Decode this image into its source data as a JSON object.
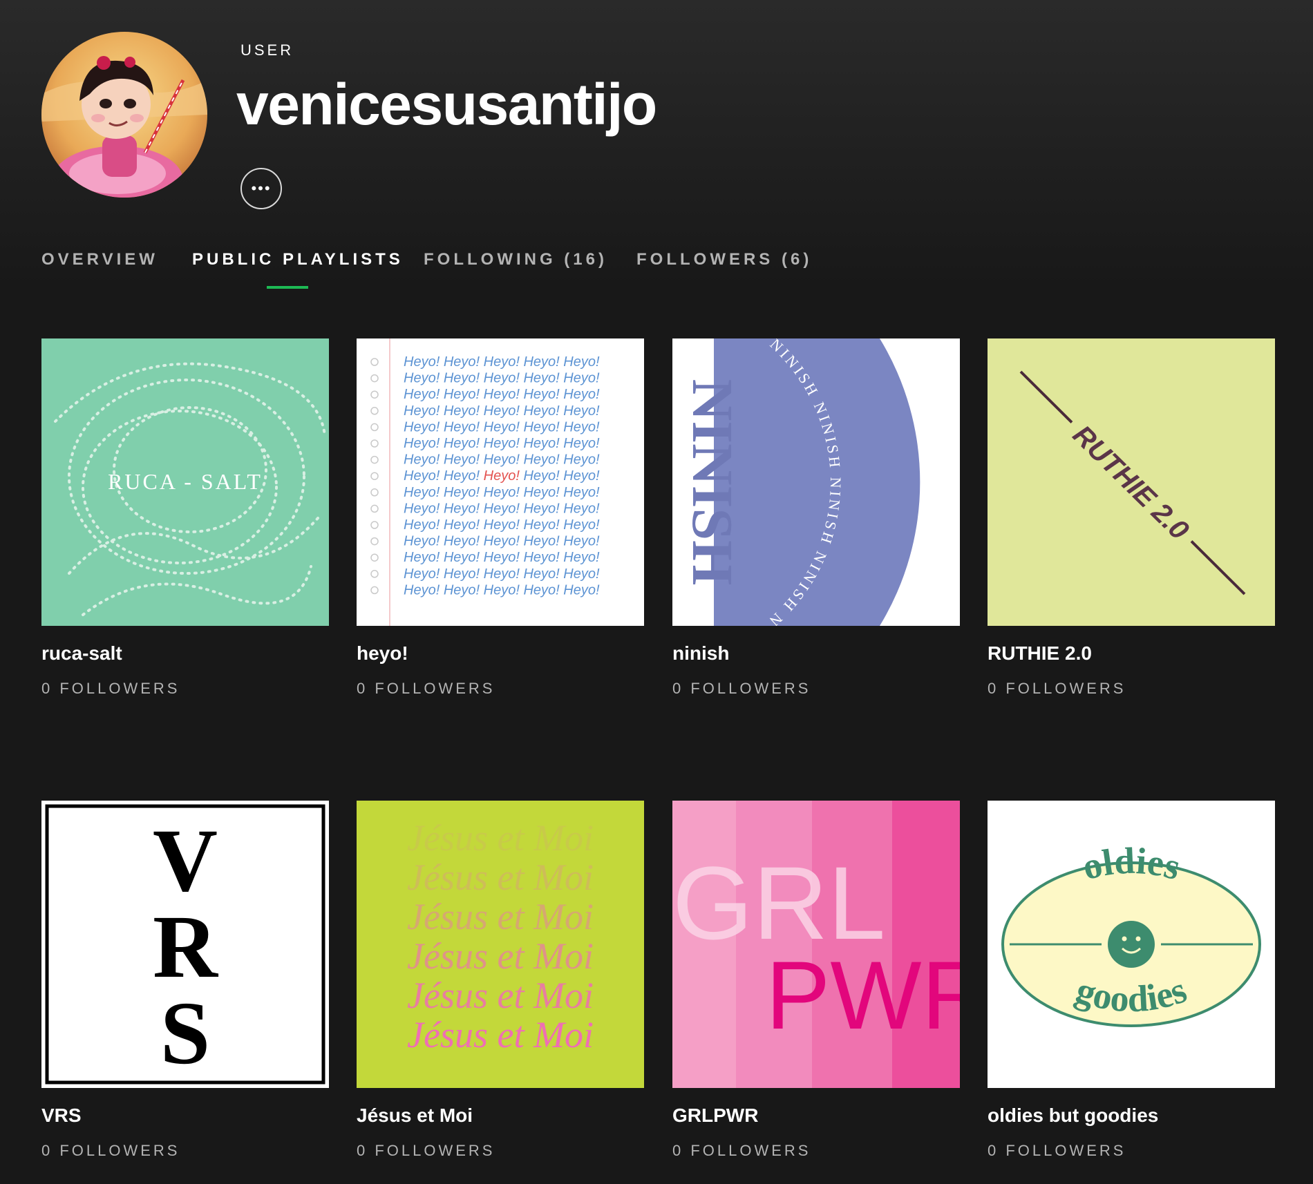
{
  "profile": {
    "type_label": "USER",
    "username": "venicesusantijo",
    "more_label": "•••"
  },
  "tabs": [
    {
      "label": "OVERVIEW",
      "active": false
    },
    {
      "label": "PUBLIC PLAYLISTS",
      "active": true
    },
    {
      "label": "FOLLOWING (16)",
      "active": false
    },
    {
      "label": "FOLLOWERS (6)",
      "active": false
    }
  ],
  "colors": {
    "background": "#181818",
    "accent": "#1db954",
    "muted_text": "#b3b3b3"
  },
  "playlists": [
    {
      "title": "ruca-salt",
      "followers": "0 FOLLOWERS",
      "cover_text": "RUCA - SALT"
    },
    {
      "title": "heyo!",
      "followers": "0 FOLLOWERS",
      "cover_text": "Heyo!"
    },
    {
      "title": "ninish",
      "followers": "0 FOLLOWERS",
      "cover_text": "NINISH"
    },
    {
      "title": "RUTHIE 2.0",
      "followers": "0 FOLLOWERS",
      "cover_text": "RUTHIE 2.0"
    },
    {
      "title": "VRS",
      "followers": "0 FOLLOWERS",
      "cover_text": [
        "V",
        "R",
        "S"
      ]
    },
    {
      "title": "Jésus et Moi",
      "followers": "0 FOLLOWERS",
      "cover_text": "Jésus et Moi"
    },
    {
      "title": "GRLPWR",
      "followers": "0 FOLLOWERS",
      "cover_text": [
        "GRL",
        "PWR"
      ]
    },
    {
      "title": "oldies but goodies",
      "followers": "0 FOLLOWERS",
      "cover_text": [
        "oldies",
        "goodies"
      ]
    }
  ]
}
